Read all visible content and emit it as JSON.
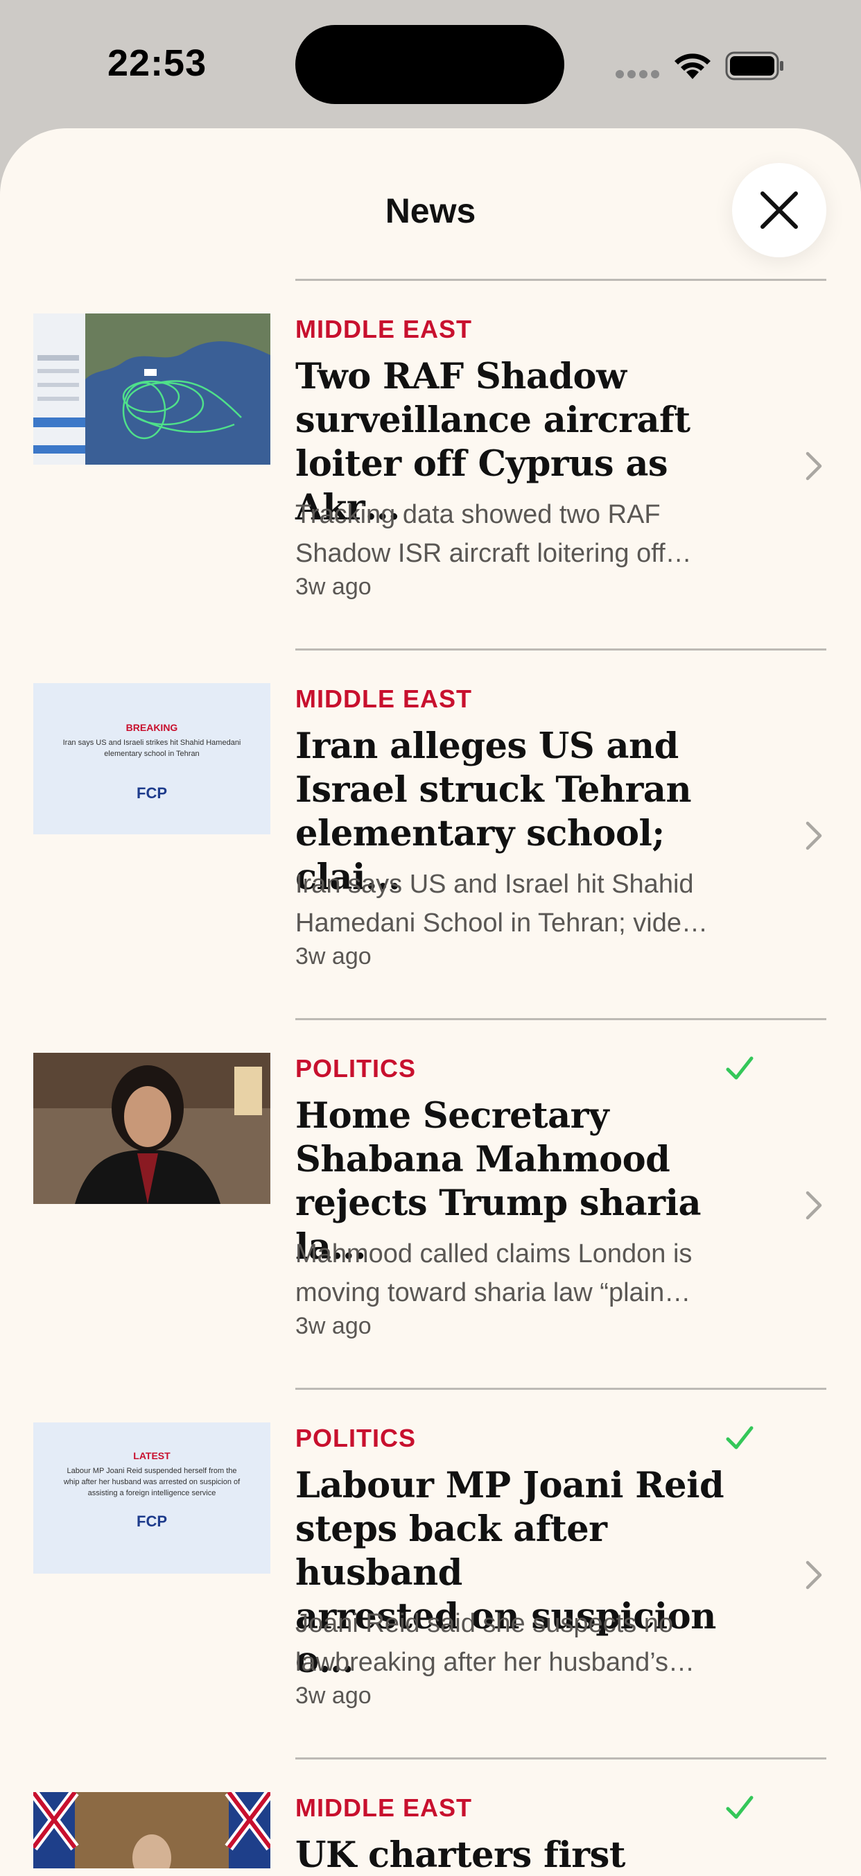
{
  "status_bar": {
    "time": "22:53"
  },
  "sheet": {
    "title": "News"
  },
  "articles": [
    {
      "category": "MIDDLE EAST",
      "headline": "Two RAF Shadow\nsurveillance aircraft\nloiter off Cyprus as Akr…",
      "summary": "Tracking data showed two RAF\nShadow ISR aircraft loitering off…",
      "time": "3w ago",
      "read": false,
      "thumb": "map"
    },
    {
      "category": "MIDDLE EAST",
      "headline": "Iran alleges US and\nIsrael struck Tehran\nelementary school; clai…",
      "summary": "Iran says US and Israel hit Shahid\nHamedani School in Tehran; vide…",
      "time": "3w ago",
      "read": false,
      "thumb": "card",
      "thumb_label": "BREAKING",
      "thumb_text": "Iran says US and Israeli strikes hit Shahid Hamedani elementary school in Tehran",
      "thumb_logo": "FCP"
    },
    {
      "category": "POLITICS",
      "headline": "Home Secretary\nShabana Mahmood\nrejects Trump sharia la…",
      "summary": "Mahmood called claims London is\nmoving toward sharia law “plain…",
      "time": "3w ago",
      "read": true,
      "thumb": "photo"
    },
    {
      "category": "POLITICS",
      "headline": "Labour MP Joani Reid\nsteps back after husband\narrested on suspicion o…",
      "summary": "Joani Reid said she suspects no\nlawbreaking after her husband’s…",
      "time": "3w ago",
      "read": true,
      "thumb": "card",
      "thumb_label": "LATEST",
      "thumb_text": "Labour MP Joani Reid suspended herself from the whip after her husband was arrested on suspicion of assisting a foreign intelligence service",
      "thumb_logo": "FCP"
    },
    {
      "category": "MIDDLE EAST",
      "headline": "UK charters first",
      "summary": "",
      "time": "",
      "read": true,
      "thumb": "photo2"
    }
  ],
  "colors": {
    "accent": "#c8102e",
    "check": "#34c759",
    "background": "#fdf8f1"
  }
}
